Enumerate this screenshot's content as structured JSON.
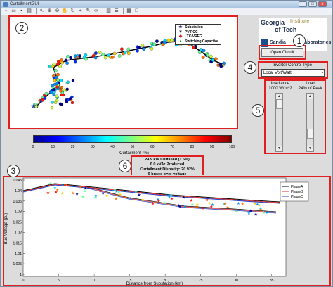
{
  "window": {
    "title": "CurtailmentGUI",
    "minimize": "_",
    "maximize": "□",
    "close": "x"
  },
  "toolbar": {
    "icons": [
      "new-file-icon",
      "open-folder-icon",
      "save-icon",
      "print-icon",
      "pointer-icon",
      "zoom-in-icon",
      "zoom-out-icon",
      "pan-icon",
      "rotate-icon",
      "data-cursor-icon",
      "brush-icon",
      "link-icon",
      "colorbar-icon",
      "legend-icon",
      "grid-icon",
      "square-icon"
    ]
  },
  "callouts": [
    "1",
    "2",
    "3",
    "4",
    "5",
    "6"
  ],
  "map": {
    "legend": [
      {
        "symbol": "★",
        "color": "#1a1a6e",
        "label": "Substation"
      },
      {
        "symbol": "✶",
        "color": "#222222",
        "label": "PV PCC"
      },
      {
        "symbol": "◆",
        "color": "#c62828",
        "label": "LTC/VREG"
      },
      {
        "symbol": "▲",
        "color": "#2e7d32",
        "label": "Switching Capacitor"
      }
    ]
  },
  "colorbar": {
    "ticks": [
      "0",
      "10",
      "20",
      "30",
      "40",
      "50",
      "60",
      "70",
      "80",
      "90",
      "100"
    ],
    "label": "Curtailment (%)"
  },
  "logos": {
    "georgia_tech_line1": "Georgia",
    "georgia_tech_line2": "Institute",
    "georgia_tech_line3": "of Tech",
    "sandia_left": "Sandia",
    "sandia_right": "Laboratories"
  },
  "controls": {
    "open_circuit_button": "Open Circuit",
    "inverter_type_label": "Inverter Control Type",
    "inverter_type_value": "Local Volt/Watt",
    "irradiance_label": "Irradiance",
    "irradiance_value": "1000 W/m^2",
    "load_label": "Load",
    "load_value": "24% of Peak"
  },
  "stats": {
    "line1": "24.9 kW Curtailed (1.6%)",
    "line2": "0.0 kVAr Produced",
    "line3": "Curtailment Disparity: 20.92%",
    "line4": "0 buses over-voltage"
  },
  "profile_plot": {
    "xlabel": "Distance from Substation (km)",
    "ylabel": "Bus Voltage (pu)",
    "x_ticks": [
      "0",
      "5",
      "10",
      "15",
      "20",
      "25",
      "30",
      "35"
    ],
    "y_ticks": [
      "1",
      "1.005",
      "1.01",
      "1.015",
      "1.02",
      "1.025",
      "1.03",
      "1.035",
      "1.04",
      "1.045"
    ],
    "legend": [
      {
        "label": "PhaseA",
        "color": "#000000"
      },
      {
        "label": "PhaseB",
        "color": "#e03030"
      },
      {
        "label": "PhaseC",
        "color": "#2040c0"
      }
    ]
  }
}
